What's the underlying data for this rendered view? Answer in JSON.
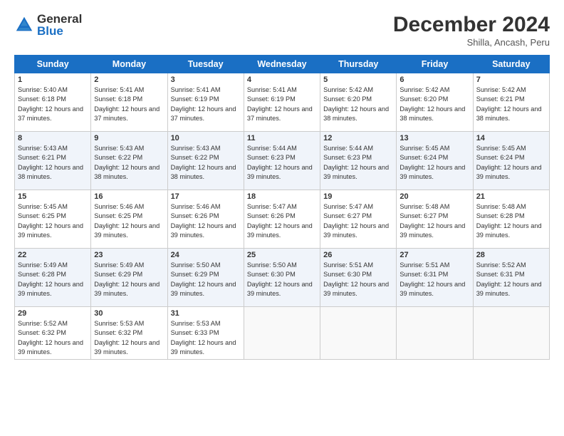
{
  "logo": {
    "general": "General",
    "blue": "Blue"
  },
  "header": {
    "title": "December 2024",
    "location": "Shilla, Ancash, Peru"
  },
  "weekdays": [
    "Sunday",
    "Monday",
    "Tuesday",
    "Wednesday",
    "Thursday",
    "Friday",
    "Saturday"
  ],
  "weeks": [
    [
      {
        "day": "1",
        "info": "Sunrise: 5:40 AM\nSunset: 6:18 PM\nDaylight: 12 hours and 37 minutes."
      },
      {
        "day": "2",
        "info": "Sunrise: 5:41 AM\nSunset: 6:18 PM\nDaylight: 12 hours and 37 minutes."
      },
      {
        "day": "3",
        "info": "Sunrise: 5:41 AM\nSunset: 6:19 PM\nDaylight: 12 hours and 37 minutes."
      },
      {
        "day": "4",
        "info": "Sunrise: 5:41 AM\nSunset: 6:19 PM\nDaylight: 12 hours and 37 minutes."
      },
      {
        "day": "5",
        "info": "Sunrise: 5:42 AM\nSunset: 6:20 PM\nDaylight: 12 hours and 38 minutes."
      },
      {
        "day": "6",
        "info": "Sunrise: 5:42 AM\nSunset: 6:20 PM\nDaylight: 12 hours and 38 minutes."
      },
      {
        "day": "7",
        "info": "Sunrise: 5:42 AM\nSunset: 6:21 PM\nDaylight: 12 hours and 38 minutes."
      }
    ],
    [
      {
        "day": "8",
        "info": "Sunrise: 5:43 AM\nSunset: 6:21 PM\nDaylight: 12 hours and 38 minutes."
      },
      {
        "day": "9",
        "info": "Sunrise: 5:43 AM\nSunset: 6:22 PM\nDaylight: 12 hours and 38 minutes."
      },
      {
        "day": "10",
        "info": "Sunrise: 5:43 AM\nSunset: 6:22 PM\nDaylight: 12 hours and 38 minutes."
      },
      {
        "day": "11",
        "info": "Sunrise: 5:44 AM\nSunset: 6:23 PM\nDaylight: 12 hours and 39 minutes."
      },
      {
        "day": "12",
        "info": "Sunrise: 5:44 AM\nSunset: 6:23 PM\nDaylight: 12 hours and 39 minutes."
      },
      {
        "day": "13",
        "info": "Sunrise: 5:45 AM\nSunset: 6:24 PM\nDaylight: 12 hours and 39 minutes."
      },
      {
        "day": "14",
        "info": "Sunrise: 5:45 AM\nSunset: 6:24 PM\nDaylight: 12 hours and 39 minutes."
      }
    ],
    [
      {
        "day": "15",
        "info": "Sunrise: 5:45 AM\nSunset: 6:25 PM\nDaylight: 12 hours and 39 minutes."
      },
      {
        "day": "16",
        "info": "Sunrise: 5:46 AM\nSunset: 6:25 PM\nDaylight: 12 hours and 39 minutes."
      },
      {
        "day": "17",
        "info": "Sunrise: 5:46 AM\nSunset: 6:26 PM\nDaylight: 12 hours and 39 minutes."
      },
      {
        "day": "18",
        "info": "Sunrise: 5:47 AM\nSunset: 6:26 PM\nDaylight: 12 hours and 39 minutes."
      },
      {
        "day": "19",
        "info": "Sunrise: 5:47 AM\nSunset: 6:27 PM\nDaylight: 12 hours and 39 minutes."
      },
      {
        "day": "20",
        "info": "Sunrise: 5:48 AM\nSunset: 6:27 PM\nDaylight: 12 hours and 39 minutes."
      },
      {
        "day": "21",
        "info": "Sunrise: 5:48 AM\nSunset: 6:28 PM\nDaylight: 12 hours and 39 minutes."
      }
    ],
    [
      {
        "day": "22",
        "info": "Sunrise: 5:49 AM\nSunset: 6:28 PM\nDaylight: 12 hours and 39 minutes."
      },
      {
        "day": "23",
        "info": "Sunrise: 5:49 AM\nSunset: 6:29 PM\nDaylight: 12 hours and 39 minutes."
      },
      {
        "day": "24",
        "info": "Sunrise: 5:50 AM\nSunset: 6:29 PM\nDaylight: 12 hours and 39 minutes."
      },
      {
        "day": "25",
        "info": "Sunrise: 5:50 AM\nSunset: 6:30 PM\nDaylight: 12 hours and 39 minutes."
      },
      {
        "day": "26",
        "info": "Sunrise: 5:51 AM\nSunset: 6:30 PM\nDaylight: 12 hours and 39 minutes."
      },
      {
        "day": "27",
        "info": "Sunrise: 5:51 AM\nSunset: 6:31 PM\nDaylight: 12 hours and 39 minutes."
      },
      {
        "day": "28",
        "info": "Sunrise: 5:52 AM\nSunset: 6:31 PM\nDaylight: 12 hours and 39 minutes."
      }
    ],
    [
      {
        "day": "29",
        "info": "Sunrise: 5:52 AM\nSunset: 6:32 PM\nDaylight: 12 hours and 39 minutes."
      },
      {
        "day": "30",
        "info": "Sunrise: 5:53 AM\nSunset: 6:32 PM\nDaylight: 12 hours and 39 minutes."
      },
      {
        "day": "31",
        "info": "Sunrise: 5:53 AM\nSunset: 6:33 PM\nDaylight: 12 hours and 39 minutes."
      },
      null,
      null,
      null,
      null
    ]
  ]
}
